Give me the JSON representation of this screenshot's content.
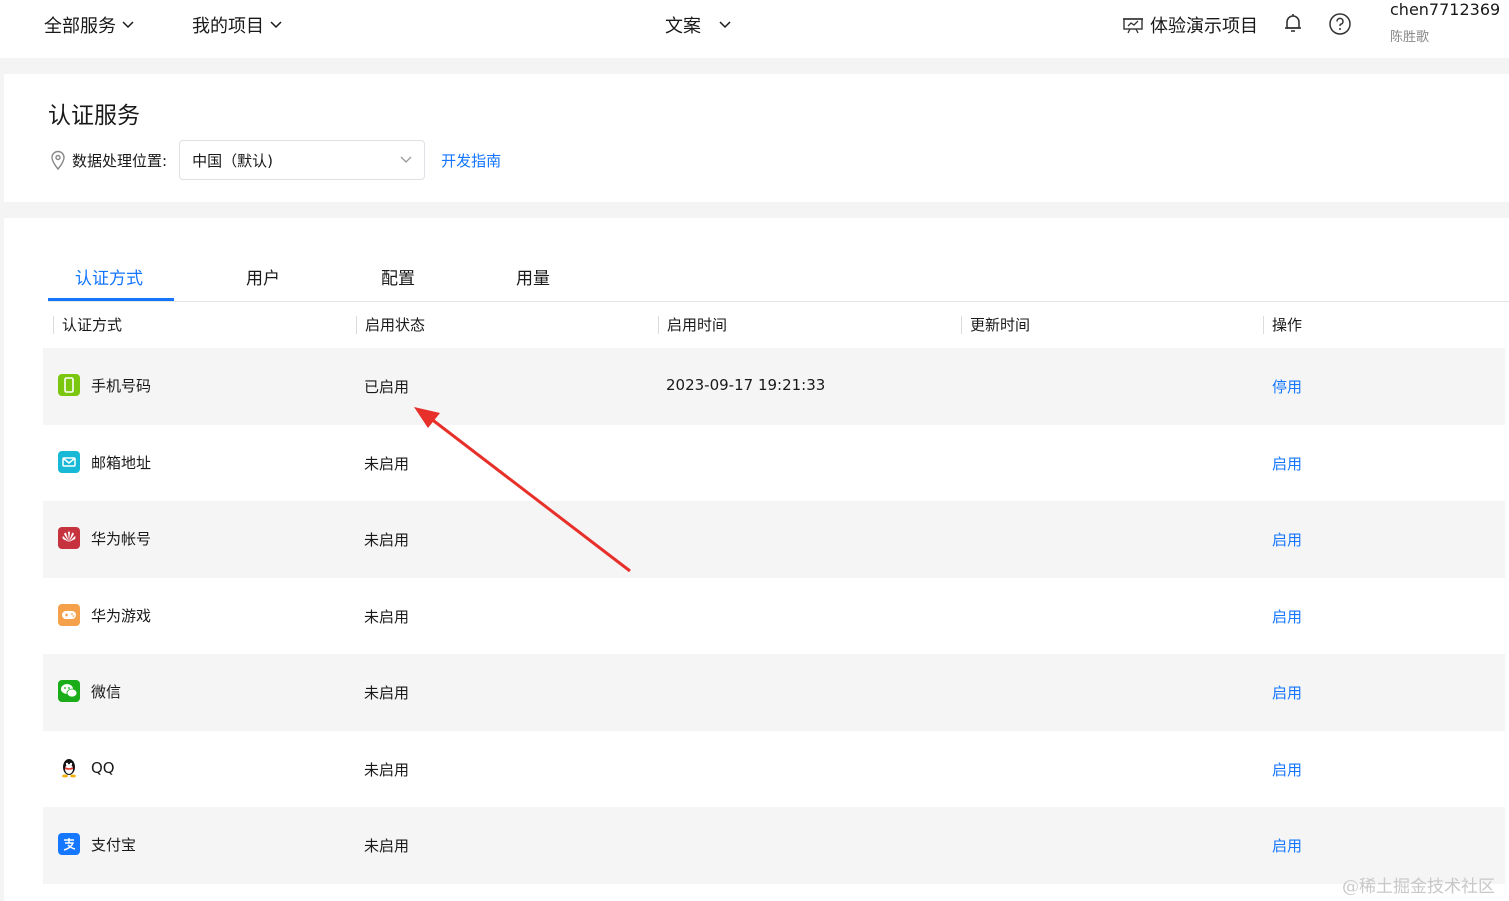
{
  "topbar": {
    "all_services": "全部服务",
    "my_projects": "我的项目",
    "project_name": "文案",
    "demo_project": "体验演示项目",
    "username": "chen7712369",
    "real_name": "陈胜歌"
  },
  "header": {
    "title": "认证服务",
    "location_label": "数据处理位置:",
    "location_value": "中国（默认)",
    "guide_link": "开发指南"
  },
  "tabs": [
    {
      "label": "认证方式",
      "active": true
    },
    {
      "label": "用户",
      "active": false
    },
    {
      "label": "配置",
      "active": false
    },
    {
      "label": "用量",
      "active": false
    }
  ],
  "table": {
    "columns": [
      "认证方式",
      "启用状态",
      "启用时间",
      "更新时间",
      "操作"
    ],
    "rows": [
      {
        "icon": "phone-icon",
        "method": "手机号码",
        "status": "已启用",
        "enabled_time": "2023-09-17 19:21:33",
        "updated_time": "",
        "action": "停用"
      },
      {
        "icon": "email-icon",
        "method": "邮箱地址",
        "status": "未启用",
        "enabled_time": "",
        "updated_time": "",
        "action": "启用"
      },
      {
        "icon": "huawei-icon",
        "method": "华为帐号",
        "status": "未启用",
        "enabled_time": "",
        "updated_time": "",
        "action": "启用"
      },
      {
        "icon": "gamepad-icon",
        "method": "华为游戏",
        "status": "未启用",
        "enabled_time": "",
        "updated_time": "",
        "action": "启用"
      },
      {
        "icon": "wechat-icon",
        "method": "微信",
        "status": "未启用",
        "enabled_time": "",
        "updated_time": "",
        "action": "启用"
      },
      {
        "icon": "qq-icon",
        "method": "QQ",
        "status": "未启用",
        "enabled_time": "",
        "updated_time": "",
        "action": "启用"
      },
      {
        "icon": "alipay-icon",
        "method": "支付宝",
        "status": "未启用",
        "enabled_time": "",
        "updated_time": "",
        "action": "启用"
      }
    ]
  },
  "colors": {
    "accent": "#1476ff",
    "arrow": "#e8302a",
    "row_stripe": "#f5f5f5"
  },
  "watermark": "@稀土掘金技术社区"
}
